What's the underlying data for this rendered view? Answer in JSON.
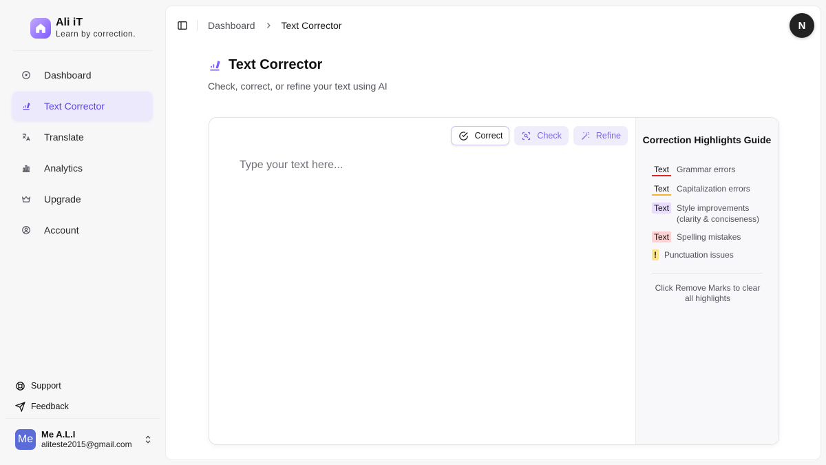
{
  "brand": {
    "name": "Ali iT",
    "tagline": "Learn by correction."
  },
  "sidebar": {
    "items": [
      {
        "label": "Dashboard",
        "icon": "gauge-icon",
        "active": false
      },
      {
        "label": "Text Corrector",
        "icon": "pen-line-icon",
        "active": true
      },
      {
        "label": "Translate",
        "icon": "translate-icon",
        "active": false
      },
      {
        "label": "Analytics",
        "icon": "bar-chart-icon",
        "active": false
      },
      {
        "label": "Upgrade",
        "icon": "crown-icon",
        "active": false
      },
      {
        "label": "Account",
        "icon": "user-circle-icon",
        "active": false
      }
    ],
    "support_label": "Support",
    "feedback_label": "Feedback"
  },
  "user": {
    "initials": "Me",
    "name": "Me A.L.I",
    "email": "aliteste2015@gmail.com",
    "fab_initial": "N"
  },
  "breadcrumb": {
    "parent": "Dashboard",
    "current": "Text Corrector"
  },
  "page": {
    "title": "Text Corrector",
    "subtitle": "Check, correct, or refine your text using AI"
  },
  "editor": {
    "placeholder": "Type your text here...",
    "buttons": {
      "correct": "Correct",
      "check": "Check",
      "refine": "Refine"
    }
  },
  "guide": {
    "title": "Correction Highlights Guide",
    "items": [
      {
        "sample": "Text",
        "label": "Grammar errors"
      },
      {
        "sample": "Text",
        "label": "Capitalization errors"
      },
      {
        "sample": "Text",
        "label": "Style improvements (clarity & conciseness)"
      },
      {
        "sample": "Text",
        "label": "Spelling mistakes"
      },
      {
        "sample": "!",
        "label": "Punctuation issues"
      }
    ],
    "note": "Click Remove Marks to clear all highlights"
  },
  "colors": {
    "accent": "#5b46e5",
    "active_bg": "#ece9fd",
    "grammar": "#dc2626",
    "capitalization": "#f5b335",
    "style": "#e9dcff",
    "spelling": "#fed2d2",
    "punctuation": "#fde68a"
  }
}
